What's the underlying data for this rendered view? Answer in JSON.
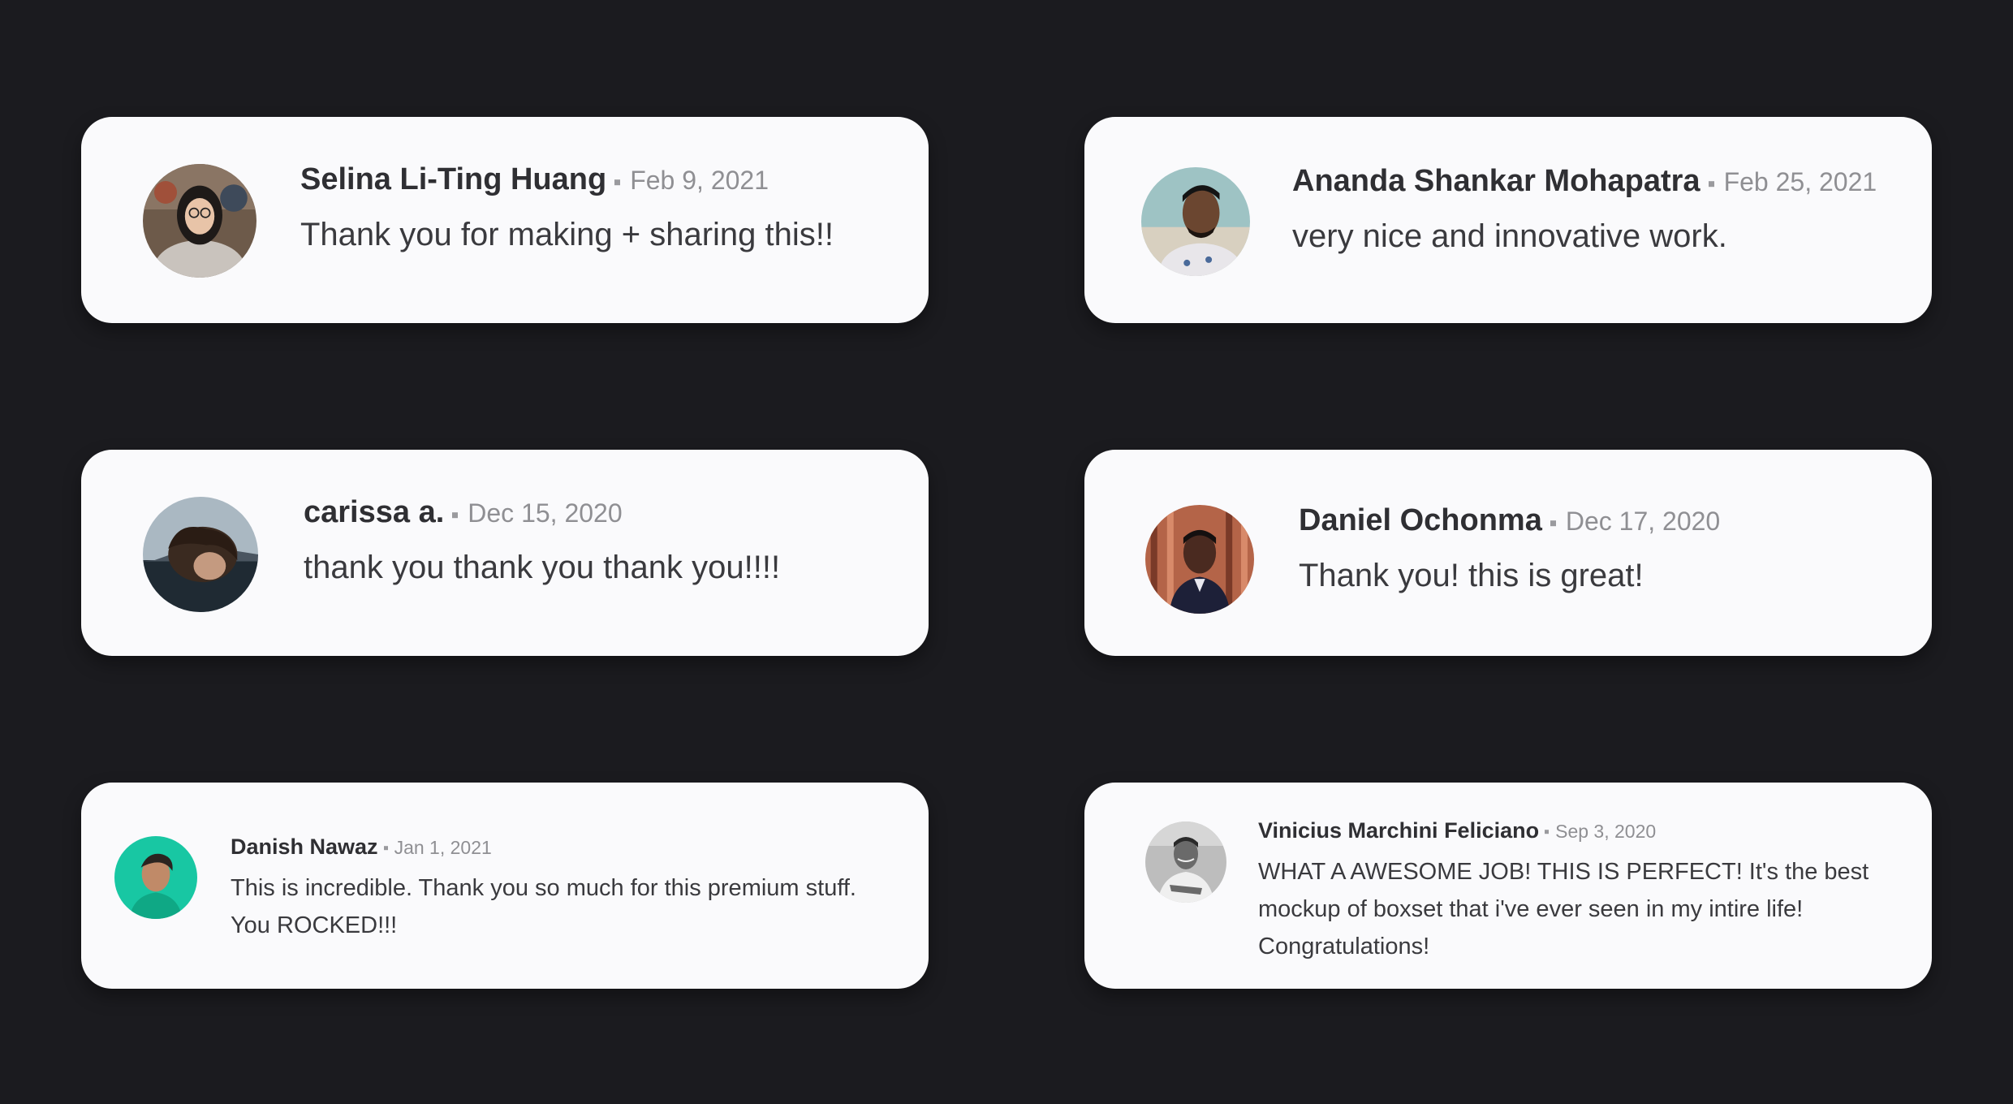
{
  "testimonials": [
    {
      "name": "Selina Li-Ting Huang",
      "date": "Feb 9, 2021",
      "message": "Thank you for making + sharing this!!",
      "avatar_icon": "avatar-selina",
      "avatar_colors": [
        "#6d5a4a",
        "#c9c3bd",
        "#1e1a18"
      ]
    },
    {
      "name": "Ananda Shankar Mohapatra",
      "date": "Feb 25, 2021",
      "message": "very nice and innovative work.",
      "avatar_icon": "avatar-ananda",
      "avatar_colors": [
        "#9ec3c4",
        "#6b4630",
        "#e8e6ea"
      ]
    },
    {
      "name": "carissa a.",
      "date": "Dec 15, 2020",
      "message": "thank you thank you thank you!!!!",
      "avatar_icon": "avatar-carissa",
      "avatar_colors": [
        "#aab8c2",
        "#3a2a20",
        "#1f2a33"
      ]
    },
    {
      "name": "Daniel Ochonma",
      "date": "Dec 17, 2020",
      "message": "Thank you! this is great!",
      "avatar_icon": "avatar-daniel",
      "avatar_colors": [
        "#b46448",
        "#1d2038",
        "#4a2a20"
      ]
    },
    {
      "name": "Danish Nawaz",
      "date": "Jan 1, 2021",
      "message_lines": [
        "This is incredible. Thank you so much for this premium stuff.",
        "You ROCKED!!!"
      ],
      "avatar_icon": "avatar-danish",
      "avatar_colors": [
        "#18c7a3",
        "#2a2420",
        "#0fa885"
      ]
    },
    {
      "name": "Vinicius Marchini Feliciano",
      "date": "Sep 3, 2020",
      "message_lines": [
        "WHAT A AWESOME JOB! THIS IS PERFECT! It's the best",
        "mockup of boxset that i've ever seen in my intire life!",
        "Congratulations!"
      ],
      "avatar_icon": "avatar-vinicius",
      "avatar_colors": [
        "#bdbdbd",
        "#3c3c3c",
        "#efefef"
      ]
    }
  ],
  "colors": {
    "background": "#1b1b1f",
    "card": "#fafafc",
    "name": "#2f2f33",
    "date": "#8f8f93",
    "message": "#3a3a3e"
  }
}
